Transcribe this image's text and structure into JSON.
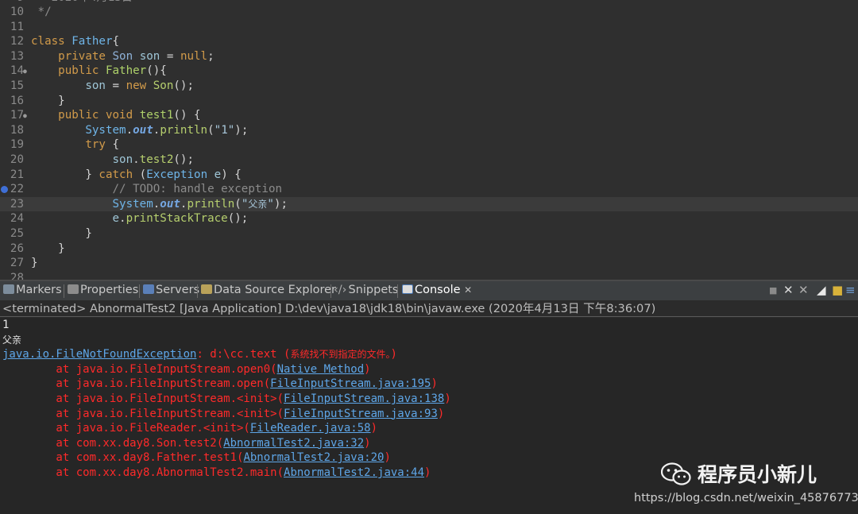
{
  "editor": {
    "lines": [
      {
        "n": "10",
        "text": " */"
      },
      {
        "n": "11",
        "text": ""
      },
      {
        "n": "12",
        "text": "class Father{"
      },
      {
        "n": "13",
        "text": "    private Son son = null;"
      },
      {
        "n": "14",
        "text": "    public Father(){"
      },
      {
        "n": "15",
        "text": "        son = new Son();"
      },
      {
        "n": "16",
        "text": "    }"
      },
      {
        "n": "17",
        "text": "    public void test1() {"
      },
      {
        "n": "18",
        "text": "        System.out.println(\"1\");"
      },
      {
        "n": "19",
        "text": "        try {"
      },
      {
        "n": "20",
        "text": "            son.test2();"
      },
      {
        "n": "21",
        "text": "        } catch (Exception e) {"
      },
      {
        "n": "22",
        "text": "            // TODO: handle exception"
      },
      {
        "n": "23",
        "text": "            System.out.println(\"父亲\");"
      },
      {
        "n": "24",
        "text": "            e.printStackTrace();"
      },
      {
        "n": "25",
        "text": "        }"
      },
      {
        "n": "26",
        "text": "    }"
      },
      {
        "n": "27",
        "text": "}"
      }
    ]
  },
  "tabs": [
    {
      "label": "Markers"
    },
    {
      "label": "Properties"
    },
    {
      "label": "Servers"
    },
    {
      "label": "Data Source Explorer"
    },
    {
      "label": "Snippets"
    },
    {
      "label": "Console"
    }
  ],
  "status": "<terminated> AbnormalTest2 [Java Application] D:\\dev\\java18\\jdk18\\bin\\javaw.exe (2020年4月13日 下午8:36:07)",
  "console": {
    "out1": "1",
    "out2": "父亲",
    "exception": "java.io.FileNotFoundException",
    "exception_msg": ": d:\\cc.text (",
    "exception_cn": "系统找不到指定的文件。",
    "exception_end": ")",
    "trace": [
      {
        "at": "        at java.io.FileInputStream.open0(",
        "link": "Native Method",
        "end": ")"
      },
      {
        "at": "        at java.io.FileInputStream.open(",
        "link": "FileInputStream.java:195",
        "end": ")"
      },
      {
        "at": "        at java.io.FileInputStream.<init>(",
        "link": "FileInputStream.java:138",
        "end": ")"
      },
      {
        "at": "        at java.io.FileInputStream.<init>(",
        "link": "FileInputStream.java:93",
        "end": ")"
      },
      {
        "at": "        at java.io.FileReader.<init>(",
        "link": "FileReader.java:58",
        "end": ")"
      },
      {
        "at": "        at com.xx.day8.Son.test2(",
        "link": "AbnormalTest2.java:32",
        "end": ")"
      },
      {
        "at": "        at com.xx.day8.Father.test1(",
        "link": "AbnormalTest2.java:20",
        "end": ")"
      },
      {
        "at": "        at com.xx.day8.AbnormalTest2.main(",
        "link": "AbnormalTest2.java:44",
        "end": ")"
      }
    ]
  },
  "watermark": {
    "name": "程序员小新儿",
    "url": "https://blog.csdn.net/weixin_45876773"
  },
  "colors": {
    "error": "#ff2a2a",
    "link": "#5ea6e8",
    "keyword": "#d29b4a"
  }
}
